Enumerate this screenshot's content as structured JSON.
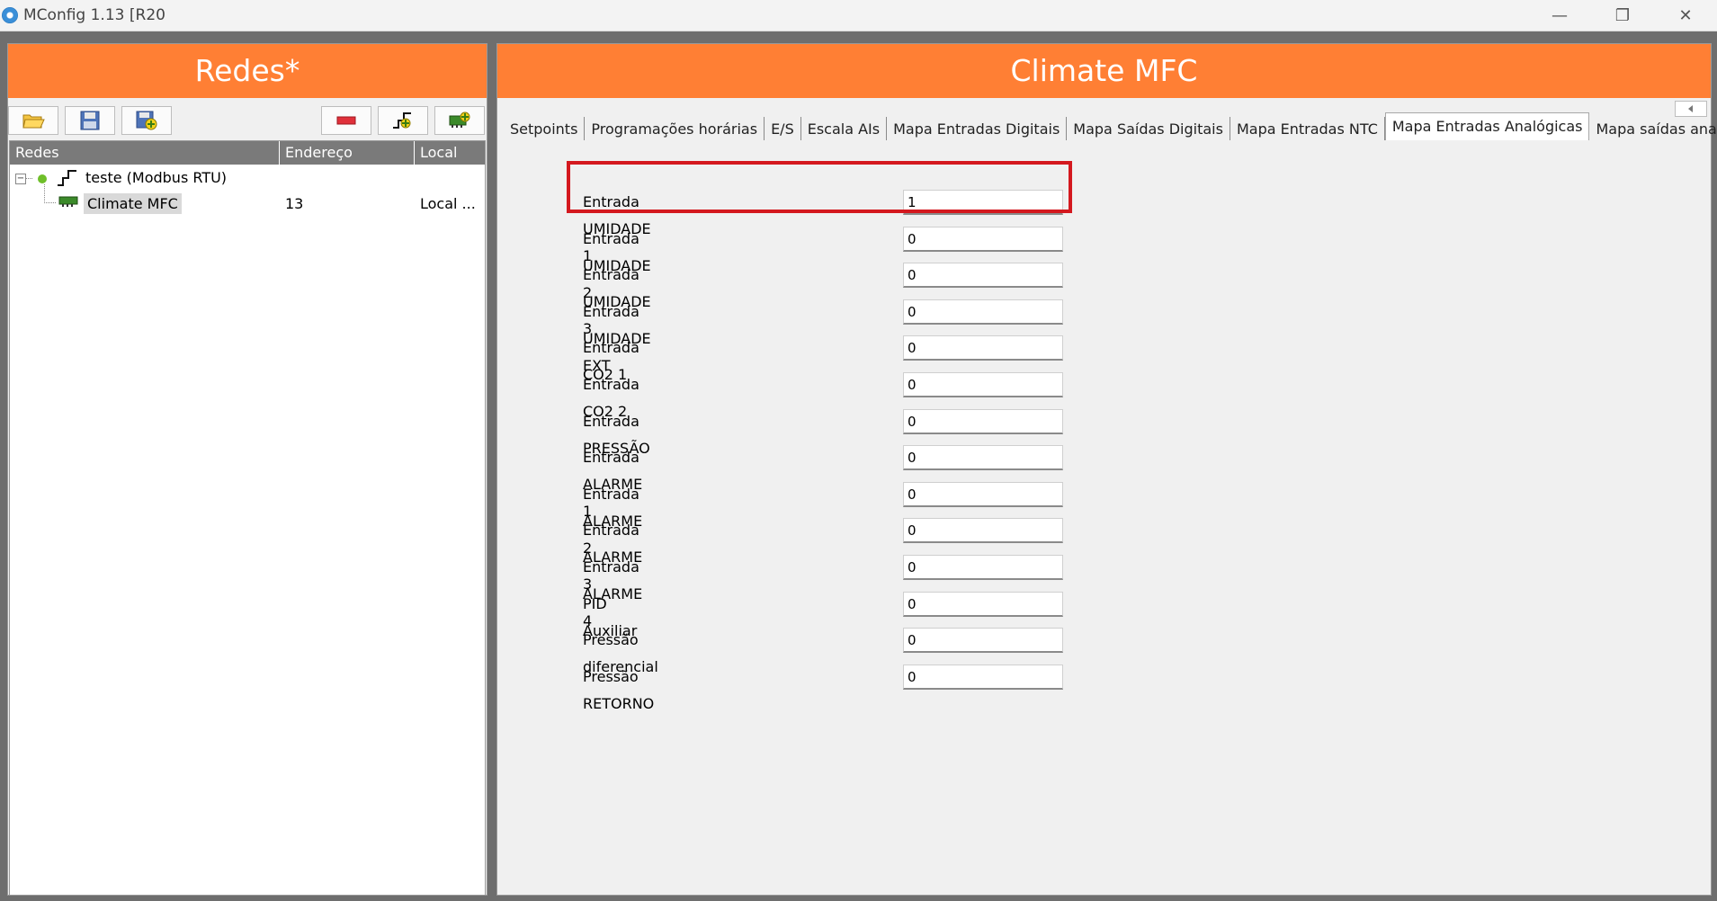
{
  "window": {
    "title": "MConfig 1.13 [R20",
    "minimize_glyph": "—",
    "restore_glyph": "❐",
    "close_glyph": "✕"
  },
  "left_panel": {
    "title": "Redes*",
    "toolbar": [
      "open-folder-icon",
      "save-icon",
      "save-add-icon",
      "remove-icon",
      "add-network-icon",
      "add-device-icon"
    ],
    "columns": [
      "Redes",
      "Endereço",
      "Local"
    ],
    "tree": {
      "network": {
        "label": "teste (Modbus RTU)",
        "status_color": "#6fbf2a"
      },
      "device": {
        "label": "Climate MFC",
        "address": "13",
        "local": "Local ..."
      }
    }
  },
  "right_panel": {
    "title": "Climate MFC",
    "tabs": [
      "Setpoints",
      "Programações horárias",
      "E/S",
      "Escala AIs",
      "Mapa Entradas Digitais",
      "Mapa Saídas Digitais",
      "Mapa Entradas NTC",
      "Mapa Entradas Analógicas",
      "Mapa saídas analógicas"
    ],
    "active_tab": "Mapa Entradas Analógicas",
    "rows": [
      {
        "label": "Entrada UMIDADE 1",
        "value": "1"
      },
      {
        "label": "Entrada UMIDADE 2",
        "value": "0"
      },
      {
        "label": "Entrada UMIDADE 3",
        "value": "0"
      },
      {
        "label": "Entrada UMIDADE EXT",
        "value": "0"
      },
      {
        "label": "Entrada CO2 1",
        "value": "0"
      },
      {
        "label": "Entrada CO2 2",
        "value": "0"
      },
      {
        "label": "Entrada PRESSÃO",
        "value": "0"
      },
      {
        "label": "Entrada ALARME 1",
        "value": "0"
      },
      {
        "label": "Entrada ALARME 2",
        "value": "0"
      },
      {
        "label": "Entrada ALARME 3",
        "value": "0"
      },
      {
        "label": "Entrada ALARME 4",
        "value": "0"
      },
      {
        "label": "PID Auxiliar",
        "value": "0"
      },
      {
        "label": "Pressão diferencial",
        "value": "0"
      },
      {
        "label": "Pressão RETORNO",
        "value": "0"
      }
    ]
  },
  "colors": {
    "accent_orange": "#ff7f34",
    "highlight_red": "#d4181e"
  }
}
